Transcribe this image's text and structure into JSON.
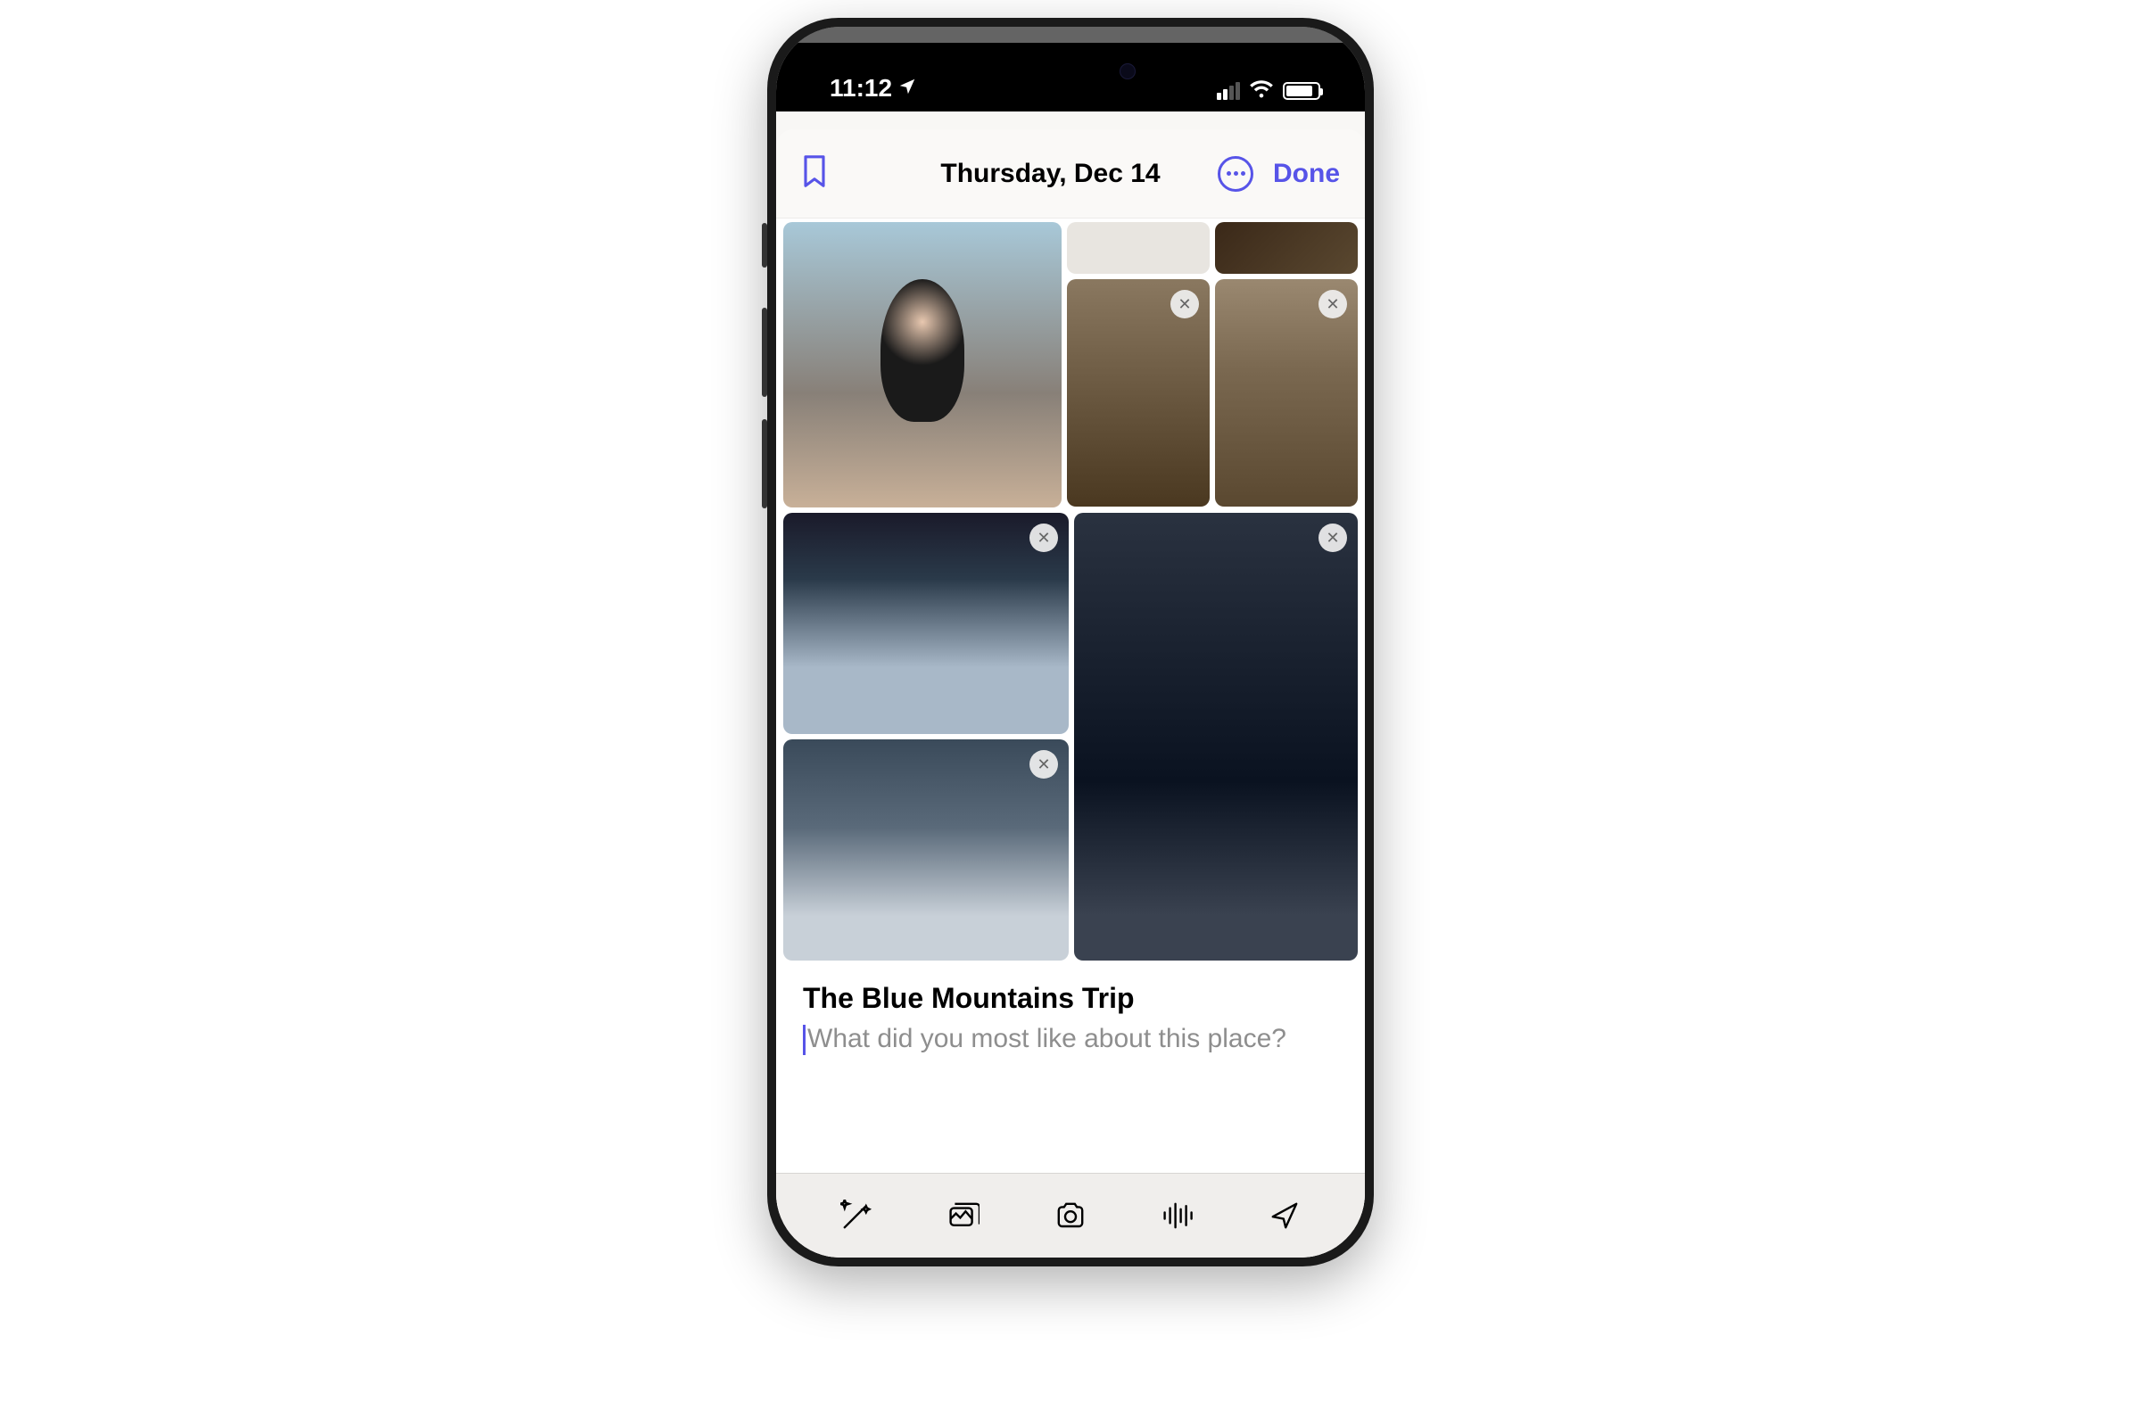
{
  "status_bar": {
    "time": "11:12",
    "location_icon": "location-arrow-icon",
    "signal_bars_filled": 2,
    "signal_bars_total": 4,
    "wifi_connected": true,
    "battery_level_pct": 85
  },
  "nav_bar": {
    "bookmark_icon": "bookmark-icon",
    "title": "Thursday, Dec 14",
    "more_icon": "ellipsis-circle-icon",
    "done_label": "Done"
  },
  "photo_grid": {
    "photos": [
      {
        "desc": "mirror-selfie",
        "has_close": false
      },
      {
        "desc": "placeholder-gray",
        "has_close": false
      },
      {
        "desc": "living-room-couch",
        "has_close": false
      },
      {
        "desc": "stone-fireplace-people",
        "has_close": true
      },
      {
        "desc": "stone-fireplace-group",
        "has_close": true
      },
      {
        "desc": "snowy-road-night-cabin",
        "has_close": true
      },
      {
        "desc": "snowy-road-night",
        "has_close": true
      },
      {
        "desc": "night-cityscape-overlook",
        "has_close": true
      }
    ]
  },
  "entry": {
    "title": "The Blue Mountains Trip",
    "placeholder": "What did you most like about this place?"
  },
  "toolbar": {
    "items": [
      {
        "name": "magic-wand-icon",
        "label": "suggestions"
      },
      {
        "name": "photo-stack-icon",
        "label": "photos"
      },
      {
        "name": "camera-icon",
        "label": "camera"
      },
      {
        "name": "waveform-icon",
        "label": "audio"
      },
      {
        "name": "location-arrow-icon",
        "label": "location"
      }
    ]
  },
  "colors": {
    "accent": "#5754e8",
    "text_primary": "#000000",
    "text_secondary": "#8e8e8e",
    "background": "#faf9f7"
  }
}
